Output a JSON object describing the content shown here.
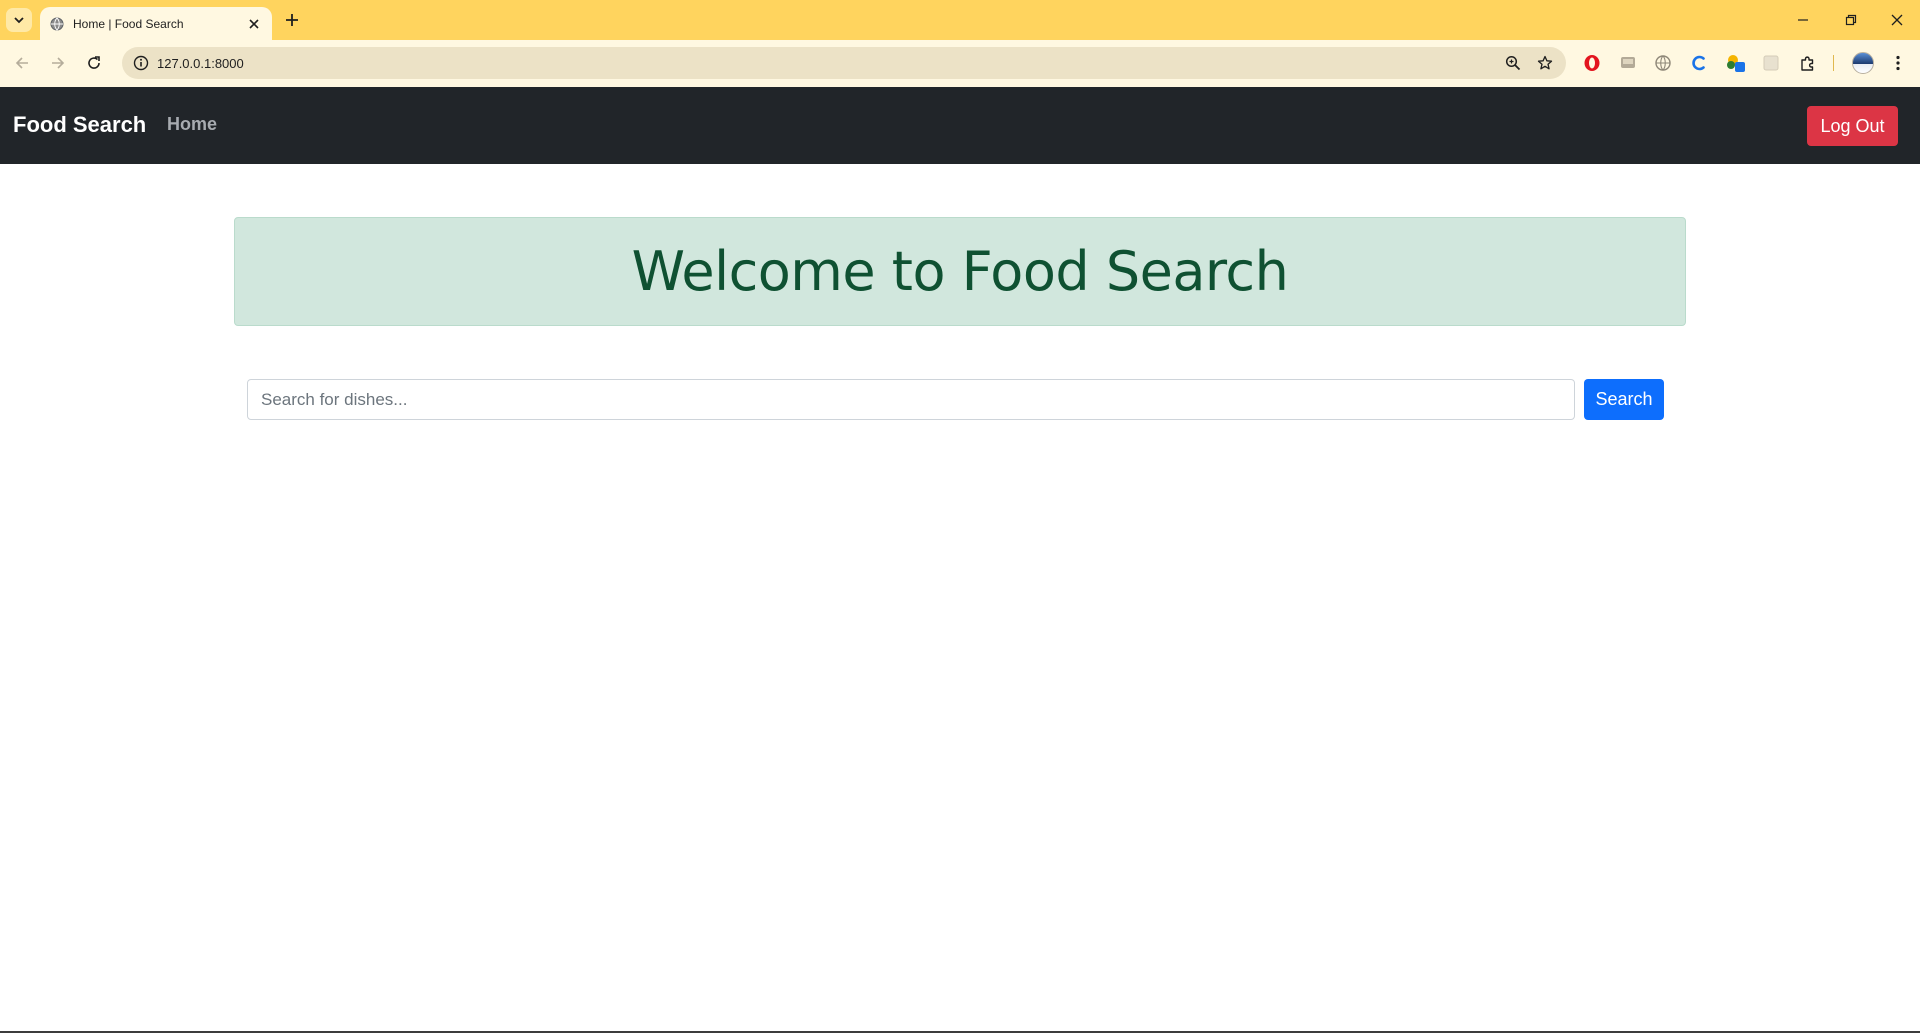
{
  "browser": {
    "tab": {
      "title": "Home | Food Search",
      "favicon": "globe-icon"
    },
    "address_bar": {
      "url": "127.0.0.1:8000"
    },
    "icons": {
      "tab_menu": "chevron-down-icon",
      "new_tab": "plus-icon",
      "back": "arrow-left-icon",
      "forward": "arrow-right-icon",
      "reload": "reload-icon",
      "site_info": "info-icon",
      "zoom": "zoom-icon",
      "bookmark": "star-icon",
      "minimize": "minimize-icon",
      "restore": "restore-icon",
      "close": "close-icon"
    },
    "colors": {
      "tabstrip": "#ffd45e",
      "toolbar": "#fff8e1",
      "omnibox": "#ece2c6"
    }
  },
  "navbar": {
    "brand": "Food Search",
    "links": [
      "Home"
    ],
    "logout_label": "Log Out",
    "colors": {
      "background": "#212529",
      "logout": "#dc3545"
    }
  },
  "main": {
    "welcome": "Welcome to Food Search",
    "search": {
      "placeholder": "Search for dishes...",
      "value": "",
      "button_label": "Search"
    },
    "colors": {
      "alert_bg": "#d1e7dd",
      "alert_text": "#0f5132",
      "primary": "#0d6efd"
    }
  }
}
